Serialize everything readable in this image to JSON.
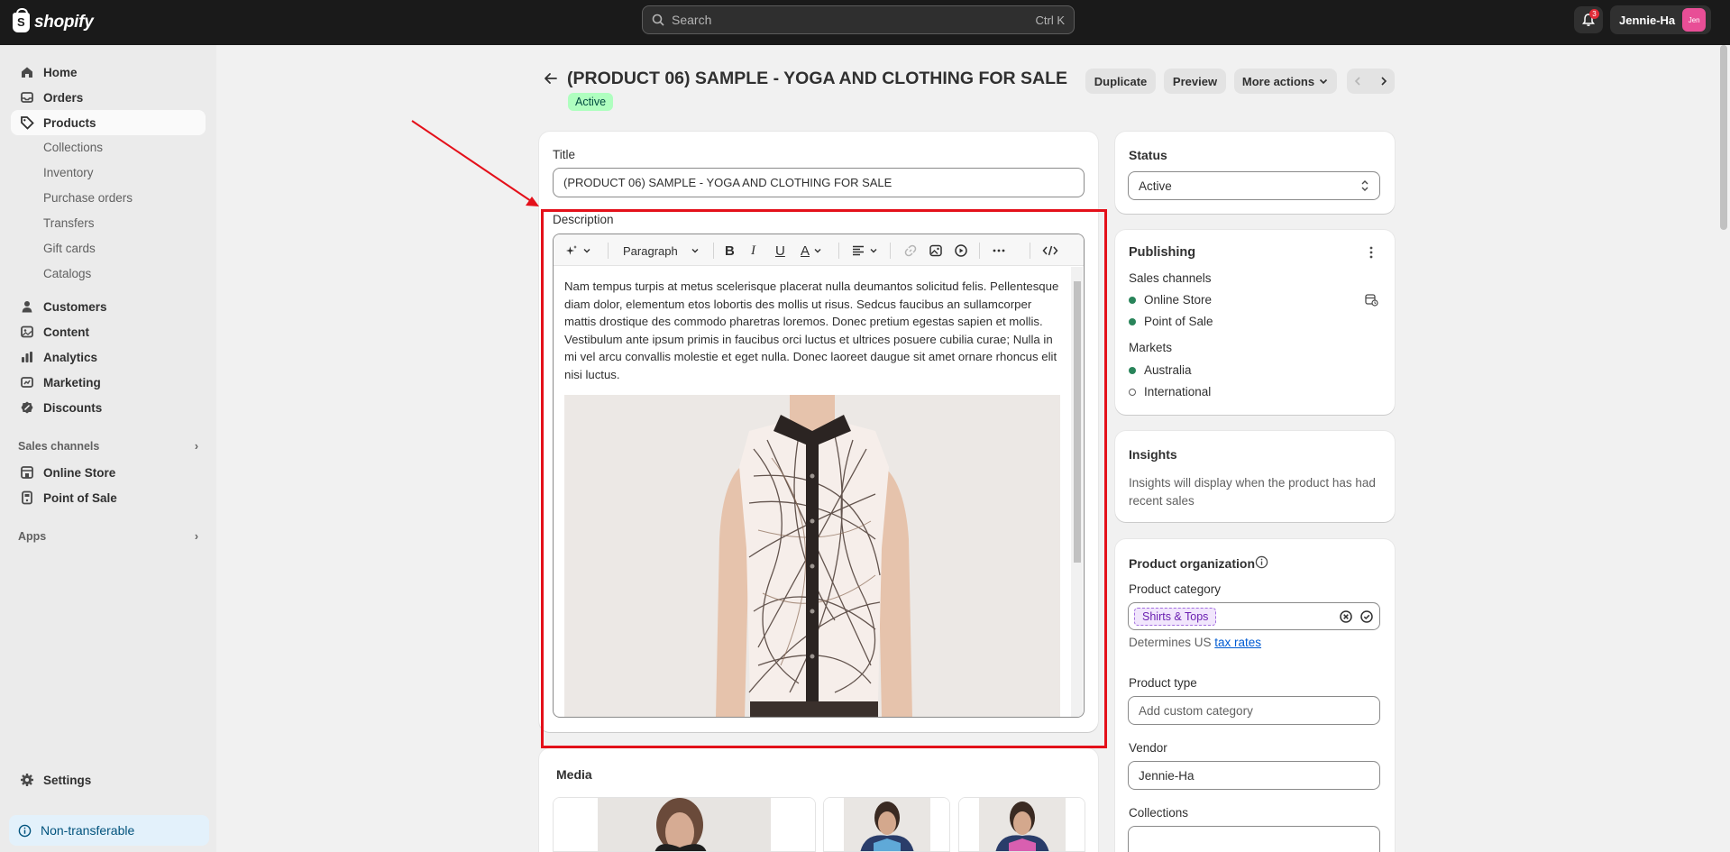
{
  "topbar": {
    "logo_text": "shopify",
    "search_placeholder": "Search",
    "search_shortcut": "Ctrl K",
    "notification_count": "3",
    "user_name": "Jennie-Ha",
    "avatar_initials": "Jen"
  },
  "sidebar": {
    "items": [
      {
        "label": "Home",
        "icon": "home-icon"
      },
      {
        "label": "Orders",
        "icon": "orders-icon"
      },
      {
        "label": "Products",
        "icon": "tag-icon",
        "active": true
      }
    ],
    "product_subitems": [
      "Collections",
      "Inventory",
      "Purchase orders",
      "Transfers",
      "Gift cards",
      "Catalogs"
    ],
    "items2": [
      {
        "label": "Customers",
        "icon": "person-icon"
      },
      {
        "label": "Content",
        "icon": "content-icon"
      },
      {
        "label": "Analytics",
        "icon": "bar-chart-icon"
      },
      {
        "label": "Marketing",
        "icon": "marketing-icon"
      },
      {
        "label": "Discounts",
        "icon": "discount-icon"
      }
    ],
    "sales_channels_label": "Sales channels",
    "channels": [
      {
        "label": "Online Store",
        "icon": "store-icon"
      },
      {
        "label": "Point of Sale",
        "icon": "pos-icon"
      }
    ],
    "apps_label": "Apps",
    "settings_label": "Settings",
    "nontransferable_label": "Non-transferable"
  },
  "header": {
    "title": "(PRODUCT 06) SAMPLE - YOGA AND CLOTHING FOR SALE",
    "status": "Active",
    "duplicate": "Duplicate",
    "preview": "Preview",
    "more_actions": "More actions"
  },
  "main": {
    "title_label": "Title",
    "title_value": "(PRODUCT 06) SAMPLE - YOGA AND CLOTHING FOR SALE",
    "description_label": "Description",
    "paragraph_select": "Paragraph",
    "description_text": "Nam tempus turpis at metus scelerisque placerat nulla deumantos solicitud felis. Pellentesque diam dolor, elementum etos lobortis des mollis ut risus. Sedcus faucibus an sullamcorper mattis drostique des commodo pharetras loremos. Donec pretium egestas sapien et mollis. Vestibulum ante ipsum primis in faucibus orci luctus et ultrices posuere cubilia curae; Nulla in mi vel arcu convallis molestie et eget nulla. Donec laoreet daugue sit amet ornare rhoncus elit nisi luctus.",
    "media_label": "Media"
  },
  "right": {
    "status_label": "Status",
    "status_value": "Active",
    "publishing_label": "Publishing",
    "sales_channels_label": "Sales channels",
    "channels": [
      "Online Store",
      "Point of Sale"
    ],
    "markets_label": "Markets",
    "markets": [
      {
        "label": "Australia",
        "active": true
      },
      {
        "label": "International",
        "active": false
      }
    ],
    "insights_label": "Insights",
    "insights_text": "Insights will display when the product has had recent sales",
    "org_label": "Product organization",
    "category_label": "Product category",
    "category_value": "Shirts & Tops",
    "tax_prefix": "Determines US ",
    "tax_link": "tax rates",
    "type_label": "Product type",
    "type_placeholder": "Add custom category",
    "vendor_label": "Vendor",
    "vendor_value": "Jennie-Ha",
    "collections_label": "Collections"
  },
  "colors": {
    "topbar": "#1a1a1a",
    "accent_green": "#29845a",
    "annotation_red": "#e4101a",
    "category_tag": "#6a1fb0"
  }
}
